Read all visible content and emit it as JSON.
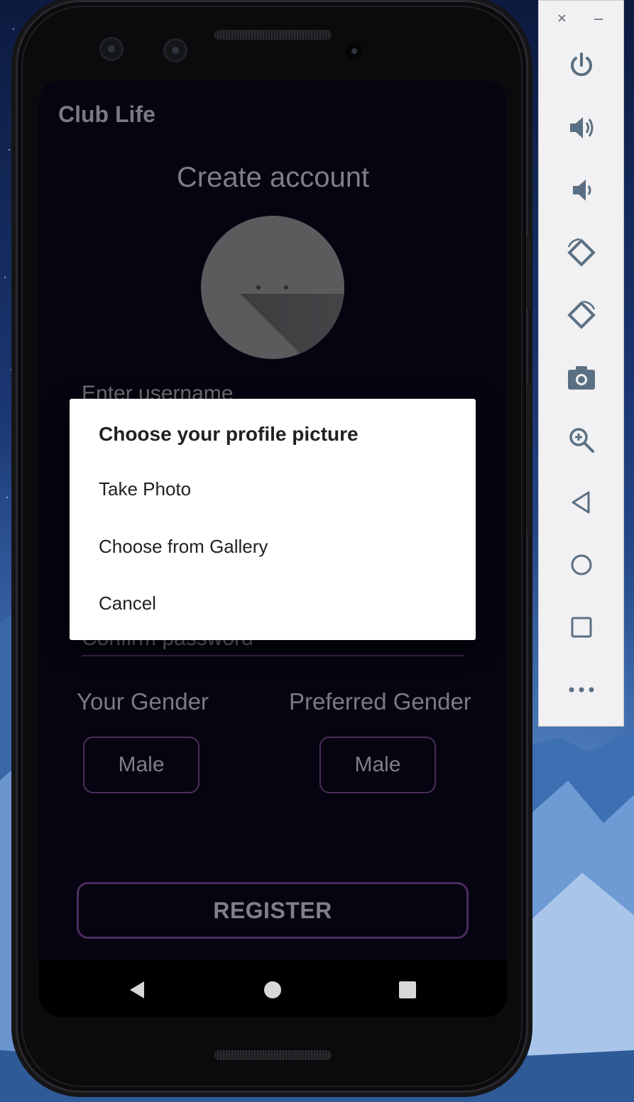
{
  "app": {
    "title": "Club Life",
    "heading": "Create account"
  },
  "form": {
    "username_placeholder": "Enter username",
    "confirm_password_placeholder": "Confirm password",
    "your_gender_label": "Your Gender",
    "preferred_gender_label": "Preferred Gender",
    "your_gender_value": "Male",
    "preferred_gender_value": "Male",
    "register_label": "REGISTER"
  },
  "dialog": {
    "title": "Choose your profile picture",
    "options": [
      "Take Photo",
      "Choose from Gallery",
      "Cancel"
    ]
  },
  "emulator_panel": {
    "close": "×",
    "minimize": "–",
    "buttons": [
      "power-icon",
      "volume-up-icon",
      "volume-down-icon",
      "rotate-left-icon",
      "rotate-right-icon",
      "camera-icon",
      "zoom-icon",
      "back-icon",
      "home-icon",
      "overview-icon",
      "more-icon"
    ]
  },
  "colors": {
    "screen_bg": "#050410",
    "accent_border": "#4a2d5a",
    "dialog_bg": "#ffffff",
    "panel_icon": "#5a6f82"
  }
}
